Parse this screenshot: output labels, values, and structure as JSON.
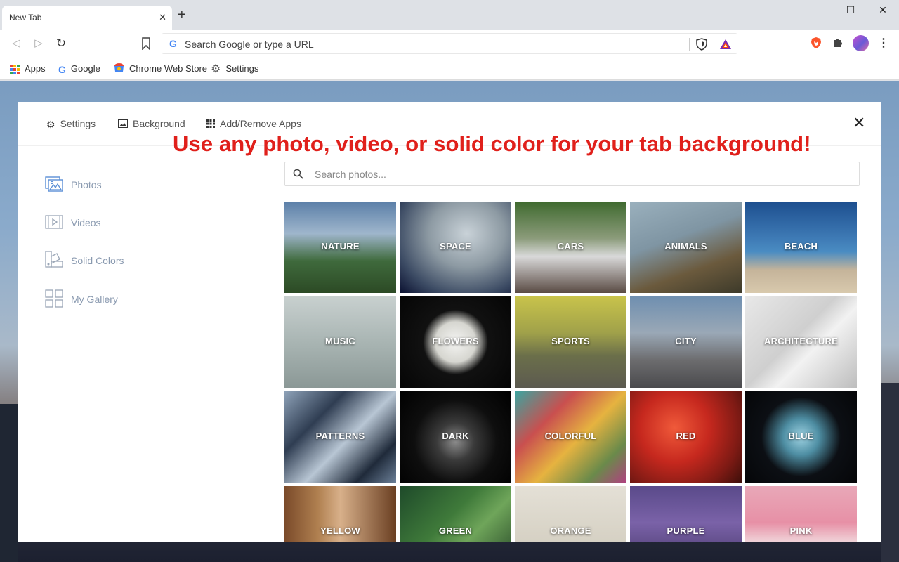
{
  "browser": {
    "tab_title": "New Tab",
    "tab_close": "✕",
    "new_tab": "+",
    "omnibox_placeholder": "Search Google or type a URL",
    "window_controls": {
      "minimize": "—",
      "maximize": "☐",
      "close": "✕"
    },
    "bookmarks": [
      {
        "label": "Apps",
        "icon": "apps-grid-icon"
      },
      {
        "label": "Google",
        "icon": "google-icon"
      },
      {
        "label": "Chrome Web Store",
        "icon": "chrome-web-store-icon"
      },
      {
        "label": "Settings",
        "icon": "gear-icon"
      }
    ]
  },
  "panel": {
    "tabs": [
      {
        "label": "Settings",
        "icon": "gear-icon"
      },
      {
        "label": "Background",
        "icon": "image-icon"
      },
      {
        "label": "Add/Remove Apps",
        "icon": "apps-grid-icon"
      }
    ],
    "close": "✕",
    "promo": "Use any photo, video, or solid color for your tab background!",
    "sidenav": [
      {
        "label": "Photos",
        "icon": "photos-icon"
      },
      {
        "label": "Videos",
        "icon": "videos-icon"
      },
      {
        "label": "Solid Colors",
        "icon": "solid-colors-icon"
      },
      {
        "label": "My Gallery",
        "icon": "gallery-icon"
      }
    ],
    "search_placeholder": "Search photos...",
    "categories": [
      "NATURE",
      "SPACE",
      "CARS",
      "ANIMALS",
      "BEACH",
      "MUSIC",
      "FLOWERS",
      "SPORTS",
      "CITY",
      "ARCHITECTURE",
      "PATTERNS",
      "DARK",
      "COLORFUL",
      "RED",
      "BLUE",
      "YELLOW",
      "GREEN",
      "ORANGE",
      "PURPLE",
      "PINK"
    ]
  },
  "colors": {
    "promo": "#e0201b",
    "sidenav_text": "#8a9ab0",
    "accent_blue": "#4285f4"
  }
}
